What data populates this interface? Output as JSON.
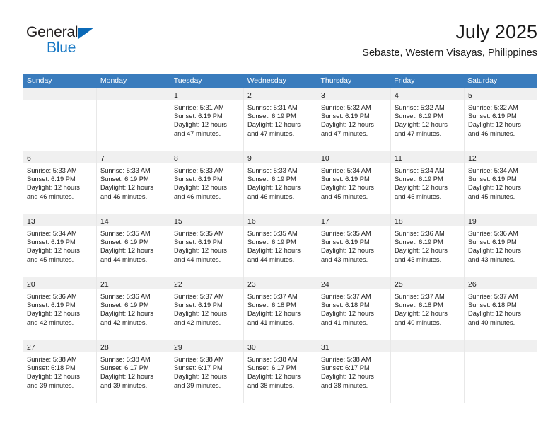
{
  "brand": {
    "name_top": "General",
    "name_bottom": "Blue",
    "triangle_color": "#0b6ab8",
    "blue_text_color": "#1577c4"
  },
  "header": {
    "title": "July 2025",
    "subtitle": "Sebaste, Western Visayas, Philippines"
  },
  "theme": {
    "header_blue": "#3a7cbd",
    "daynum_strip": "#f0f0f0",
    "row_divider": "#3a7cbd"
  },
  "weekdays": [
    "Sunday",
    "Monday",
    "Tuesday",
    "Wednesday",
    "Thursday",
    "Friday",
    "Saturday"
  ],
  "weeks": [
    [
      {
        "empty": true
      },
      {
        "empty": true
      },
      {
        "day": "1",
        "sunrise": "Sunrise: 5:31 AM",
        "sunset": "Sunset: 6:19 PM",
        "daylight": "Daylight: 12 hours and 47 minutes."
      },
      {
        "day": "2",
        "sunrise": "Sunrise: 5:31 AM",
        "sunset": "Sunset: 6:19 PM",
        "daylight": "Daylight: 12 hours and 47 minutes."
      },
      {
        "day": "3",
        "sunrise": "Sunrise: 5:32 AM",
        "sunset": "Sunset: 6:19 PM",
        "daylight": "Daylight: 12 hours and 47 minutes."
      },
      {
        "day": "4",
        "sunrise": "Sunrise: 5:32 AM",
        "sunset": "Sunset: 6:19 PM",
        "daylight": "Daylight: 12 hours and 47 minutes."
      },
      {
        "day": "5",
        "sunrise": "Sunrise: 5:32 AM",
        "sunset": "Sunset: 6:19 PM",
        "daylight": "Daylight: 12 hours and 46 minutes."
      }
    ],
    [
      {
        "day": "6",
        "sunrise": "Sunrise: 5:33 AM",
        "sunset": "Sunset: 6:19 PM",
        "daylight": "Daylight: 12 hours and 46 minutes."
      },
      {
        "day": "7",
        "sunrise": "Sunrise: 5:33 AM",
        "sunset": "Sunset: 6:19 PM",
        "daylight": "Daylight: 12 hours and 46 minutes."
      },
      {
        "day": "8",
        "sunrise": "Sunrise: 5:33 AM",
        "sunset": "Sunset: 6:19 PM",
        "daylight": "Daylight: 12 hours and 46 minutes."
      },
      {
        "day": "9",
        "sunrise": "Sunrise: 5:33 AM",
        "sunset": "Sunset: 6:19 PM",
        "daylight": "Daylight: 12 hours and 46 minutes."
      },
      {
        "day": "10",
        "sunrise": "Sunrise: 5:34 AM",
        "sunset": "Sunset: 6:19 PM",
        "daylight": "Daylight: 12 hours and 45 minutes."
      },
      {
        "day": "11",
        "sunrise": "Sunrise: 5:34 AM",
        "sunset": "Sunset: 6:19 PM",
        "daylight": "Daylight: 12 hours and 45 minutes."
      },
      {
        "day": "12",
        "sunrise": "Sunrise: 5:34 AM",
        "sunset": "Sunset: 6:19 PM",
        "daylight": "Daylight: 12 hours and 45 minutes."
      }
    ],
    [
      {
        "day": "13",
        "sunrise": "Sunrise: 5:34 AM",
        "sunset": "Sunset: 6:19 PM",
        "daylight": "Daylight: 12 hours and 45 minutes."
      },
      {
        "day": "14",
        "sunrise": "Sunrise: 5:35 AM",
        "sunset": "Sunset: 6:19 PM",
        "daylight": "Daylight: 12 hours and 44 minutes."
      },
      {
        "day": "15",
        "sunrise": "Sunrise: 5:35 AM",
        "sunset": "Sunset: 6:19 PM",
        "daylight": "Daylight: 12 hours and 44 minutes."
      },
      {
        "day": "16",
        "sunrise": "Sunrise: 5:35 AM",
        "sunset": "Sunset: 6:19 PM",
        "daylight": "Daylight: 12 hours and 44 minutes."
      },
      {
        "day": "17",
        "sunrise": "Sunrise: 5:35 AM",
        "sunset": "Sunset: 6:19 PM",
        "daylight": "Daylight: 12 hours and 43 minutes."
      },
      {
        "day": "18",
        "sunrise": "Sunrise: 5:36 AM",
        "sunset": "Sunset: 6:19 PM",
        "daylight": "Daylight: 12 hours and 43 minutes."
      },
      {
        "day": "19",
        "sunrise": "Sunrise: 5:36 AM",
        "sunset": "Sunset: 6:19 PM",
        "daylight": "Daylight: 12 hours and 43 minutes."
      }
    ],
    [
      {
        "day": "20",
        "sunrise": "Sunrise: 5:36 AM",
        "sunset": "Sunset: 6:19 PM",
        "daylight": "Daylight: 12 hours and 42 minutes."
      },
      {
        "day": "21",
        "sunrise": "Sunrise: 5:36 AM",
        "sunset": "Sunset: 6:19 PM",
        "daylight": "Daylight: 12 hours and 42 minutes."
      },
      {
        "day": "22",
        "sunrise": "Sunrise: 5:37 AM",
        "sunset": "Sunset: 6:19 PM",
        "daylight": "Daylight: 12 hours and 42 minutes."
      },
      {
        "day": "23",
        "sunrise": "Sunrise: 5:37 AM",
        "sunset": "Sunset: 6:18 PM",
        "daylight": "Daylight: 12 hours and 41 minutes."
      },
      {
        "day": "24",
        "sunrise": "Sunrise: 5:37 AM",
        "sunset": "Sunset: 6:18 PM",
        "daylight": "Daylight: 12 hours and 41 minutes."
      },
      {
        "day": "25",
        "sunrise": "Sunrise: 5:37 AM",
        "sunset": "Sunset: 6:18 PM",
        "daylight": "Daylight: 12 hours and 40 minutes."
      },
      {
        "day": "26",
        "sunrise": "Sunrise: 5:37 AM",
        "sunset": "Sunset: 6:18 PM",
        "daylight": "Daylight: 12 hours and 40 minutes."
      }
    ],
    [
      {
        "day": "27",
        "sunrise": "Sunrise: 5:38 AM",
        "sunset": "Sunset: 6:18 PM",
        "daylight": "Daylight: 12 hours and 39 minutes."
      },
      {
        "day": "28",
        "sunrise": "Sunrise: 5:38 AM",
        "sunset": "Sunset: 6:17 PM",
        "daylight": "Daylight: 12 hours and 39 minutes."
      },
      {
        "day": "29",
        "sunrise": "Sunrise: 5:38 AM",
        "sunset": "Sunset: 6:17 PM",
        "daylight": "Daylight: 12 hours and 39 minutes."
      },
      {
        "day": "30",
        "sunrise": "Sunrise: 5:38 AM",
        "sunset": "Sunset: 6:17 PM",
        "daylight": "Daylight: 12 hours and 38 minutes."
      },
      {
        "day": "31",
        "sunrise": "Sunrise: 5:38 AM",
        "sunset": "Sunset: 6:17 PM",
        "daylight": "Daylight: 12 hours and 38 minutes."
      },
      {
        "empty": true
      },
      {
        "empty": true
      }
    ]
  ]
}
